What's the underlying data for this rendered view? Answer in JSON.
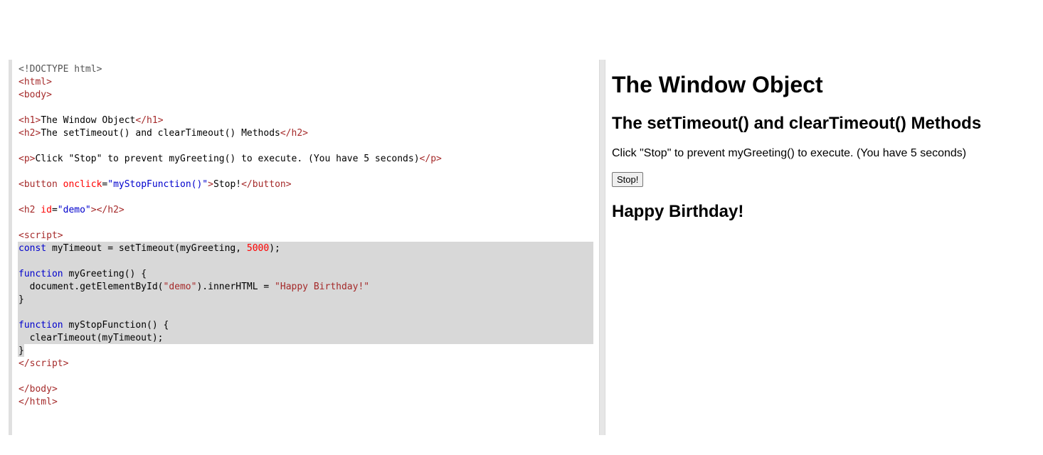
{
  "editor": {
    "lines": [
      [
        {
          "t": "<!DOCTYPE html>",
          "c": "doc"
        }
      ],
      [
        {
          "t": "<",
          "c": "tag"
        },
        {
          "t": "html",
          "c": "tag"
        },
        {
          "t": ">",
          "c": "tag"
        }
      ],
      [
        {
          "t": "<",
          "c": "tag"
        },
        {
          "t": "body",
          "c": "tag"
        },
        {
          "t": ">",
          "c": "tag"
        }
      ],
      [],
      [
        {
          "t": "<",
          "c": "tag"
        },
        {
          "t": "h1",
          "c": "tag"
        },
        {
          "t": ">",
          "c": "tag"
        },
        {
          "t": "The Window Object",
          "c": "text"
        },
        {
          "t": "</",
          "c": "tag"
        },
        {
          "t": "h1",
          "c": "tag"
        },
        {
          "t": ">",
          "c": "tag"
        }
      ],
      [
        {
          "t": "<",
          "c": "tag"
        },
        {
          "t": "h2",
          "c": "tag"
        },
        {
          "t": ">",
          "c": "tag"
        },
        {
          "t": "The setTimeout() and clearTimeout() Methods",
          "c": "text"
        },
        {
          "t": "</",
          "c": "tag"
        },
        {
          "t": "h2",
          "c": "tag"
        },
        {
          "t": ">",
          "c": "tag"
        }
      ],
      [],
      [
        {
          "t": "<",
          "c": "tag"
        },
        {
          "t": "p",
          "c": "tag"
        },
        {
          "t": ">",
          "c": "tag"
        },
        {
          "t": "Click \"Stop\" to prevent myGreeting() to execute. (You have 5 seconds)",
          "c": "text"
        },
        {
          "t": "</",
          "c": "tag"
        },
        {
          "t": "p",
          "c": "tag"
        },
        {
          "t": ">",
          "c": "tag"
        }
      ],
      [],
      [
        {
          "t": "<",
          "c": "tag"
        },
        {
          "t": "button",
          "c": "tag"
        },
        {
          "t": " onclick",
          "c": "attr"
        },
        {
          "t": "=",
          "c": "text"
        },
        {
          "t": "\"myStopFunction()\"",
          "c": "val"
        },
        {
          "t": ">",
          "c": "tag"
        },
        {
          "t": "Stop!",
          "c": "text"
        },
        {
          "t": "</",
          "c": "tag"
        },
        {
          "t": "button",
          "c": "tag"
        },
        {
          "t": ">",
          "c": "tag"
        }
      ],
      [],
      [
        {
          "t": "<",
          "c": "tag"
        },
        {
          "t": "h2",
          "c": "tag"
        },
        {
          "t": " id",
          "c": "attr"
        },
        {
          "t": "=",
          "c": "text"
        },
        {
          "t": "\"demo\"",
          "c": "val"
        },
        {
          "t": ">",
          "c": "tag"
        },
        {
          "t": "</",
          "c": "tag"
        },
        {
          "t": "h2",
          "c": "tag"
        },
        {
          "t": ">",
          "c": "tag"
        }
      ],
      [],
      [
        {
          "t": "<",
          "c": "tag"
        },
        {
          "t": "script",
          "c": "tag"
        },
        {
          "t": ">",
          "c": "tag"
        }
      ],
      [
        {
          "t": "const",
          "c": "kw"
        },
        {
          "t": " myTimeout = setTimeout(myGreeting, ",
          "c": "text"
        },
        {
          "t": "5000",
          "c": "num"
        },
        {
          "t": ");",
          "c": "text"
        }
      ],
      [],
      [
        {
          "t": "function",
          "c": "kw"
        },
        {
          "t": " myGreeting() {",
          "c": "text"
        }
      ],
      [
        {
          "t": "  document.getElementById(",
          "c": "text"
        },
        {
          "t": "\"demo\"",
          "c": "str"
        },
        {
          "t": ").innerHTML = ",
          "c": "text"
        },
        {
          "t": "\"Happy Birthday!\"",
          "c": "str"
        }
      ],
      [
        {
          "t": "}",
          "c": "text"
        }
      ],
      [],
      [
        {
          "t": "function",
          "c": "kw"
        },
        {
          "t": " myStopFunction() {",
          "c": "text"
        }
      ],
      [
        {
          "t": "  clearTimeout(myTimeout);",
          "c": "text"
        }
      ],
      [
        {
          "t": "}",
          "c": "text"
        }
      ],
      [
        {
          "t": "</",
          "c": "tag"
        },
        {
          "t": "script",
          "c": "tag"
        },
        {
          "t": ">",
          "c": "tag"
        }
      ],
      [],
      [
        {
          "t": "</",
          "c": "tag"
        },
        {
          "t": "body",
          "c": "tag"
        },
        {
          "t": ">",
          "c": "tag"
        }
      ],
      [
        {
          "t": "</",
          "c": "tag"
        },
        {
          "t": "html",
          "c": "tag"
        },
        {
          "t": ">",
          "c": "tag"
        }
      ]
    ]
  },
  "result": {
    "h1": "The Window Object",
    "h2": "The setTimeout() and clearTimeout() Methods",
    "paragraph": "Click \"Stop\" to prevent myGreeting() to execute. (You have 5 seconds)",
    "button_label": "Stop!",
    "demo_text": "Happy Birthday!"
  },
  "colors": {
    "tag": "#a52a2a",
    "attribute": "#ff0000",
    "attribute_value": "#0000cd",
    "keyword": "#0000cd",
    "string": "#a52a2a",
    "number": "#ff0000",
    "selection": "#d8d8d8"
  }
}
